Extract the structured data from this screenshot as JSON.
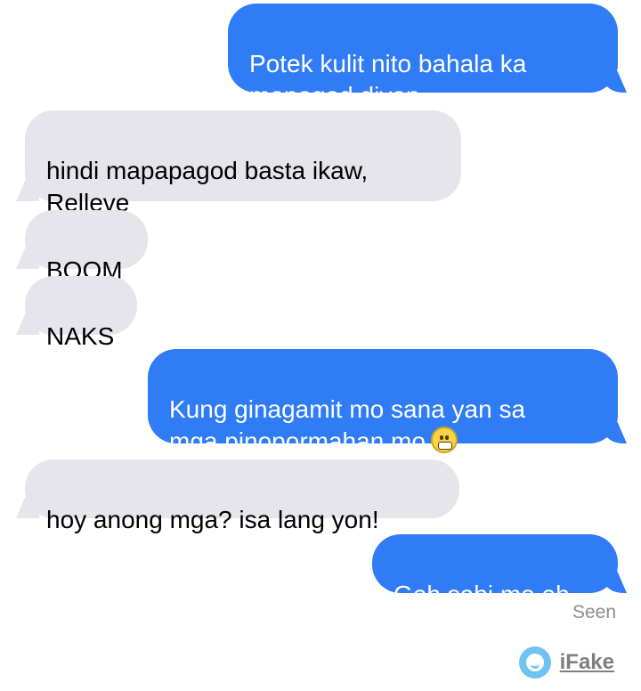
{
  "messages": [
    {
      "direction": "sent",
      "text": "Potek kulit nito bahala ka\nmapagod diyan"
    },
    {
      "direction": "received",
      "text": "hindi mapapagod basta ikaw,\nRelleve"
    },
    {
      "direction": "received",
      "text": "BOOM"
    },
    {
      "direction": "received",
      "text": "NAKS"
    },
    {
      "direction": "sent",
      "text": "Kung ginagamit mo sana yan sa\nmga pinopormahan mo",
      "emoji": "grimacing-face-emoji"
    },
    {
      "direction": "received",
      "text": "hoy anong mga? isa lang yon!"
    },
    {
      "direction": "sent",
      "text": "Geh sabi mo eh"
    }
  ],
  "status": {
    "seen_label": "Seen"
  },
  "watermark": {
    "brand": "iFake",
    "icon": "ifake-smile-logo"
  },
  "colors": {
    "sent_bubble": "#2f7cf6",
    "received_bubble": "#e6e5eb",
    "background": "#ffffff"
  }
}
